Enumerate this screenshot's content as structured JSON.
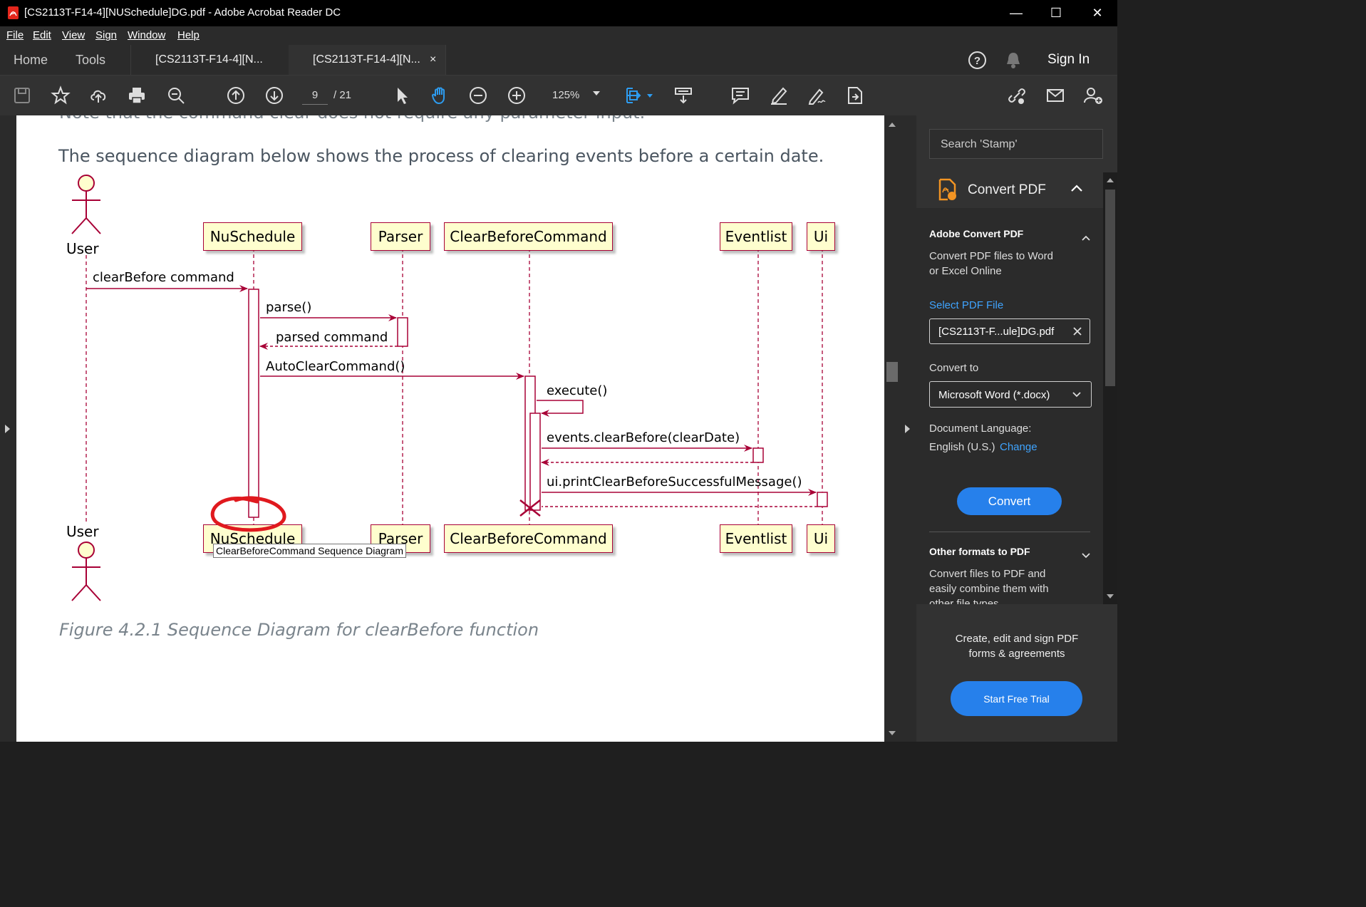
{
  "window": {
    "title": "[CS2113T-F14-4][NUSchedule]DG.pdf - Adobe Acrobat Reader DC",
    "minimize": "—",
    "maximize": "☐",
    "close": "✕"
  },
  "menu": [
    "File",
    "Edit",
    "View",
    "Sign",
    "Window",
    "Help"
  ],
  "tabs": {
    "home": "Home",
    "tools": "Tools",
    "doc1": "[CS2113T-F14-4][N...",
    "doc2": "[CS2113T-F14-4][N...",
    "doc2_close": "×",
    "sign_in": "Sign In"
  },
  "toolbar": {
    "page_current": "9",
    "page_total": "/ 21",
    "zoom": "125%"
  },
  "document": {
    "cut_line": "Note that the command clear does not require any parameter input.",
    "intro": "The sequence diagram below shows the process of clearing events before a certain date.",
    "caption": "Figure 4.2.1 Sequence Diagram for clearBefore function",
    "tooltip": "ClearBeforeCommand Sequence Diagram"
  },
  "diagram": {
    "actor": "User",
    "participants": [
      "NuSchedule",
      "Parser",
      "ClearBeforeCommand",
      "Eventlist",
      "Ui"
    ],
    "messages": [
      "clearBefore command",
      "parse()",
      "parsed command",
      "AutoClearCommand()",
      "execute()",
      "events.clearBefore(clearDate)",
      "ui.printClearBeforeSuccessfulMessage()"
    ],
    "colors": {
      "box_fill": "#fefece",
      "border": "#a80036",
      "annotation": "#e0191e"
    }
  },
  "right_panel": {
    "search_placeholder": "Search 'Stamp'",
    "section_title": "Convert PDF",
    "adobe_title": "Adobe Convert PDF",
    "adobe_desc_1": "Convert PDF files to Word",
    "adobe_desc_2": "or Excel Online",
    "select_file": "Select PDF File",
    "file_name": "[CS2113T-F...ule]DG.pdf",
    "convert_to_label": "Convert to",
    "convert_to_value": "Microsoft Word (*.docx)",
    "doc_lang_label": "Document Language:",
    "doc_lang_value": "English (U.S.)",
    "change_link": "Change",
    "convert_button": "Convert",
    "other_title": "Other formats to PDF",
    "other_desc_1": "Convert files to PDF and",
    "other_desc_2": "easily combine them with",
    "other_desc_3": "other file types",
    "promo_1": "Create, edit and sign PDF",
    "promo_2": "forms & agreements",
    "trial_button": "Start Free Trial"
  }
}
